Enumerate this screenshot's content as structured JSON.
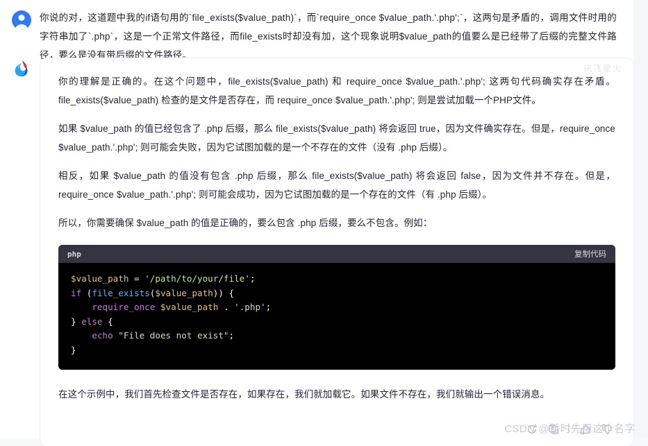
{
  "app": {
    "card_watermark": "讯飞星火",
    "page_watermark": "CSDN @暂时先用这个名字"
  },
  "user_message": {
    "avatar_name": "user-avatar",
    "text": "你说的对，这道题中我的if语句用的`file_exists($value_path)`，而`require_once $value_path.'.php';`，这两句是矛盾的，调用文件时用的字符串加了`.php`，这是一个正常文件路径，而file_exists时却没有加，这个现象说明$value_path的值要么是已经带了后缀的完整文件路径，要么是没有带后缀的文件路径。"
  },
  "assistant_message": {
    "paragraphs": [
      "你的理解是正确的。在这个问题中，file_exists($value_path) 和 require_once $value_path.'.php'; 这两句代码确实存在矛盾。file_exists($value_path) 检查的是文件是否存在，而 require_once $value_path.'.php'; 则是尝试加载一个PHP文件。",
      "如果 $value_path 的值已经包含了 .php 后缀，那么 file_exists($value_path) 将会返回 true，因为文件确实存在。但是，require_once $value_path.'.php'; 则可能会失败，因为它试图加载的是一个不存在的文件（没有 .php 后缀）。",
      "相反，如果 $value_path 的值没有包含 .php 后缀，那么 file_exists($value_path) 将会返回 false，因为文件并不存在。但是，require_once $value_path.'.php'; 则可能会成功，因为它试图加载的是一个存在的文件（有 .php 后缀）。",
      "所以，你需要确保 $value_path 的值是正确的，要么包含 .php 后缀，要么不包含。例如："
    ],
    "closing_paragraph": "在这个示例中，我们首先检查文件是否存在，如果存在，我们就加载它。如果文件不存在，我们就输出一个错误消息。",
    "code_block": {
      "language_label": "php",
      "copy_label": "复制代码",
      "lines": [
        "$value_path = '/path/to/your/file';",
        "if (file_exists($value_path)) {",
        "    require_once $value_path . '.php';",
        "} else {",
        "    echo \"File does not exist\";",
        "}"
      ]
    },
    "actions": [
      {
        "name": "regenerate-icon",
        "label": "重新生成"
      },
      {
        "name": "copy-icon",
        "label": "复制"
      },
      {
        "name": "thumbs-up-icon",
        "label": "赞"
      },
      {
        "name": "thumbs-down-icon",
        "label": "踩"
      }
    ]
  },
  "colors": {
    "page_background": "#ffffff",
    "gutter": "#f5f6f8",
    "code_header": "#343541",
    "code_background": "#000000",
    "user_avatar": "#2f7bf0",
    "accent_string": "#c3e88d",
    "accent_keyword": "#c678dd",
    "accent_function": "#61afef",
    "accent_variable": "#e5c07b"
  }
}
